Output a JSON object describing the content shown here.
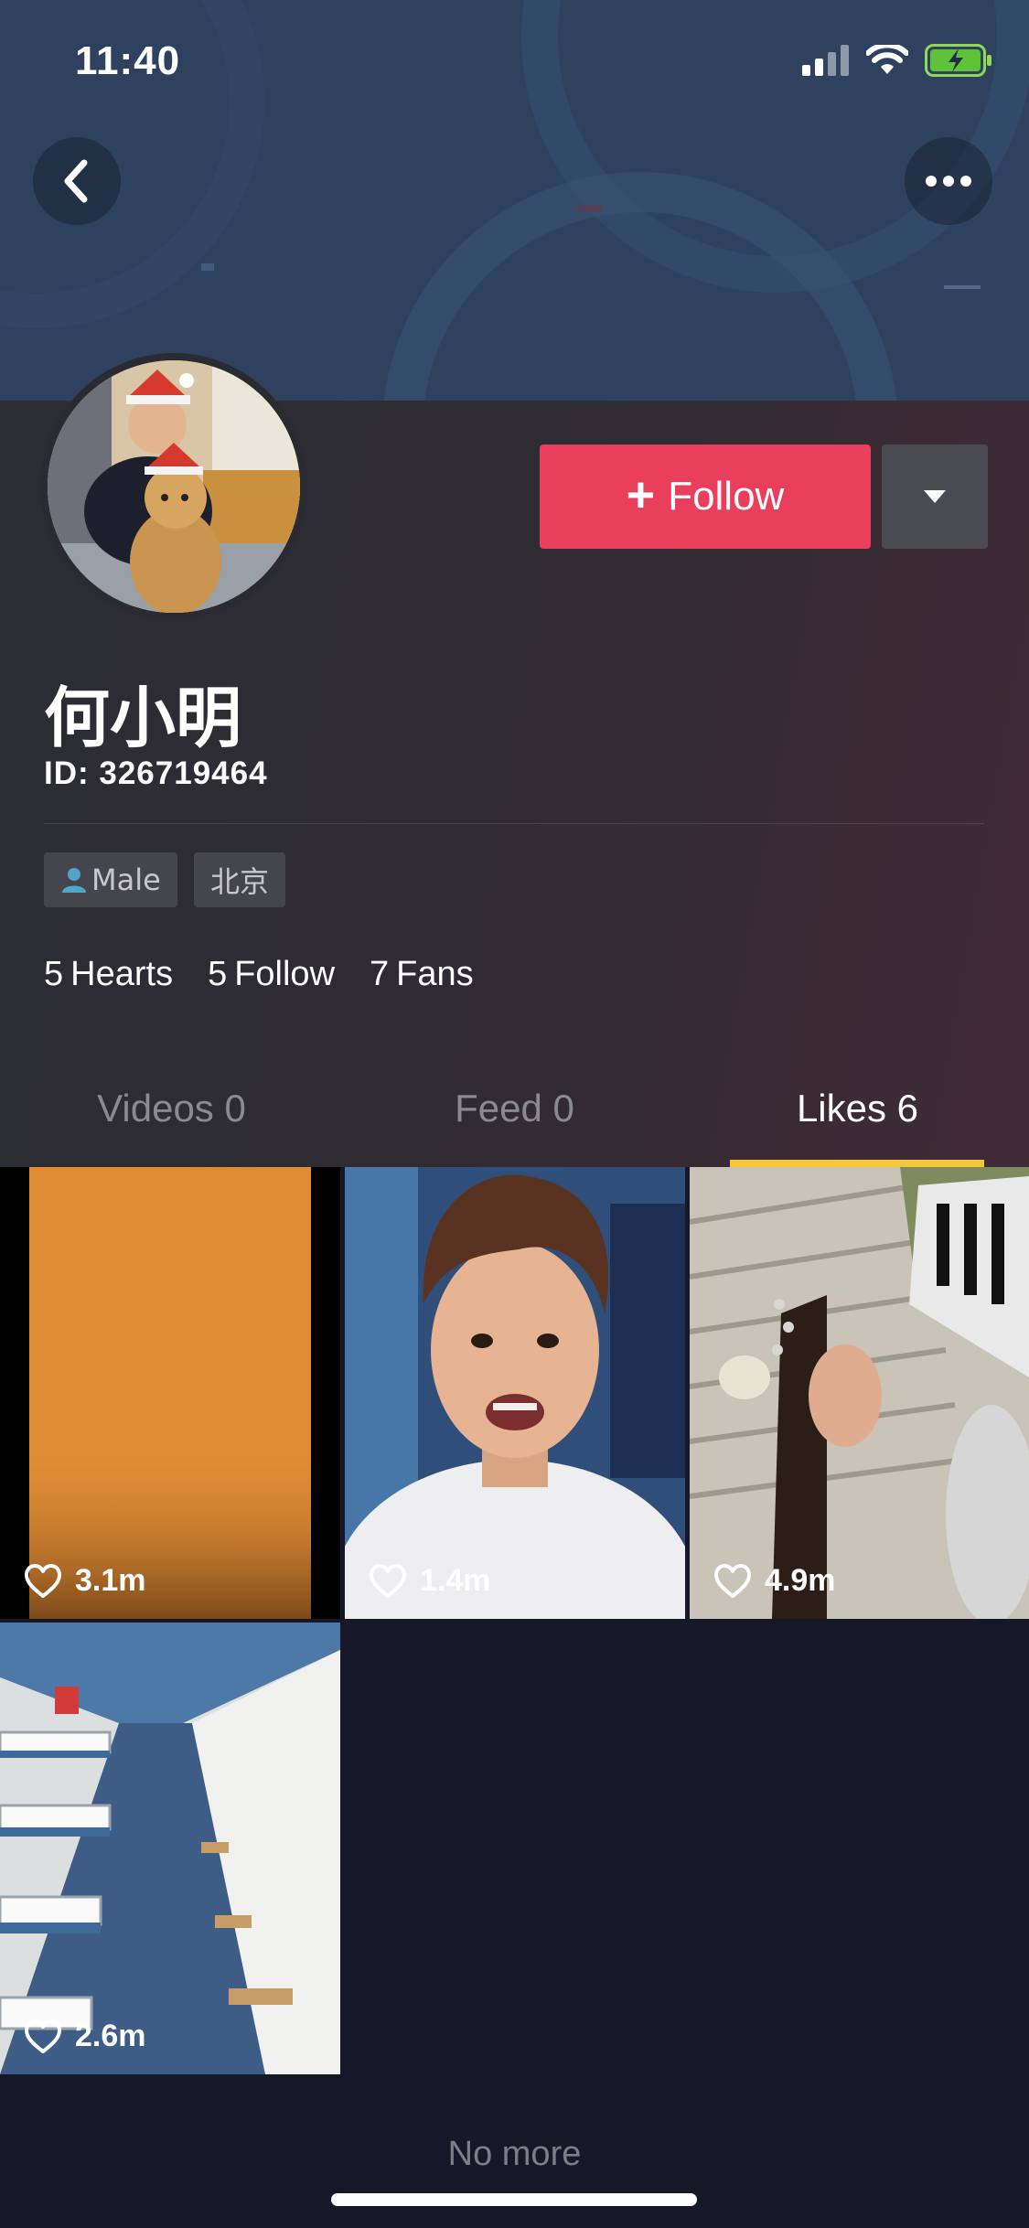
{
  "status_bar": {
    "time": "11:40"
  },
  "profile": {
    "name": "何小明",
    "id_text": "ID: 326719464",
    "follow_label": "Follow",
    "tags": {
      "gender": "Male",
      "city": "北京"
    },
    "stats": [
      {
        "value": "5",
        "label": "Hearts"
      },
      {
        "value": "5",
        "label": "Follow"
      },
      {
        "value": "7",
        "label": "Fans"
      }
    ]
  },
  "tabs": [
    {
      "label": "Videos 0"
    },
    {
      "label": "Feed 0"
    },
    {
      "label": "Likes 6",
      "active": true
    }
  ],
  "videos": [
    {
      "likes": "3.1m"
    },
    {
      "likes": "1.4m"
    },
    {
      "likes": "4.9m"
    },
    {
      "likes": "2.6m"
    }
  ],
  "footer": {
    "no_more": "No more"
  },
  "colors": {
    "follow_button": "#ea3f5c",
    "tab_underline": "#f5c73b",
    "banner": "#2e4260",
    "background": "#171827"
  }
}
